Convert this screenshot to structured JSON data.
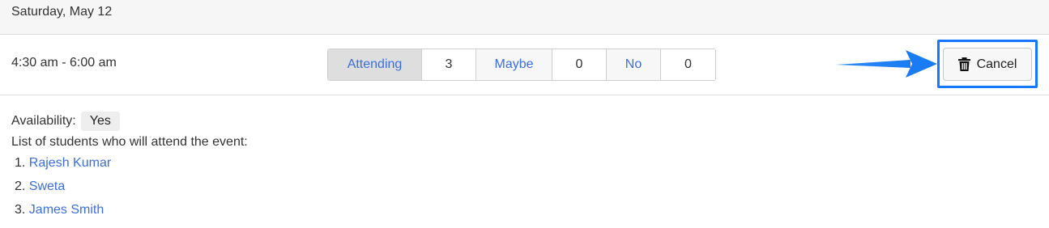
{
  "date_header": "Saturday, May 12",
  "event": {
    "time": "4:30 am - 6:00 am",
    "rsvp": {
      "attending_label": "Attending",
      "attending_count": "3",
      "maybe_label": "Maybe",
      "maybe_count": "0",
      "no_label": "No",
      "no_count": "0"
    },
    "cancel_label": "Cancel"
  },
  "availability": {
    "label": "Availability:",
    "value": "Yes"
  },
  "students_caption": "List of students who will attend the event:",
  "students": [
    {
      "num": "1.",
      "name": "Rajesh Kumar"
    },
    {
      "num": "2.",
      "name": "Sweta"
    },
    {
      "num": "3.",
      "name": "James Smith"
    }
  ],
  "colors": {
    "link": "#3b6fe0",
    "highlight": "#1677ff",
    "arrow": "#1a7cf5"
  },
  "icons": {
    "cancel": "trash-icon",
    "pointer": "arrow-right-icon"
  }
}
